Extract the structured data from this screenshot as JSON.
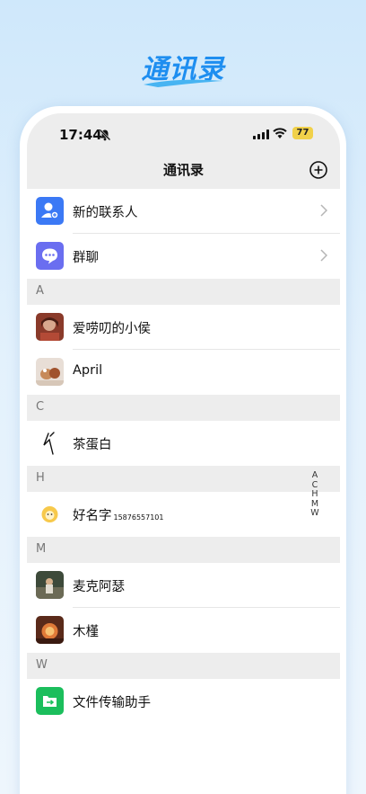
{
  "header": {
    "title": "通讯录"
  },
  "status_bar": {
    "time": "17:44",
    "battery": "77"
  },
  "nav": {
    "title": "通讯录"
  },
  "top_items": [
    {
      "label": "新的联系人",
      "icon": "new-contact-icon",
      "color": "#3b79f5"
    },
    {
      "label": "群聊",
      "icon": "group-chat-icon",
      "color": "#6a6ef0"
    }
  ],
  "sections": [
    {
      "letter": "A",
      "contacts": [
        {
          "name": "爱唠叨的小侯"
        },
        {
          "name": "April"
        }
      ]
    },
    {
      "letter": "C",
      "contacts": [
        {
          "name": "茶蛋白"
        }
      ]
    },
    {
      "letter": "H",
      "contacts": [
        {
          "name": "好名字",
          "sub": "15876557101"
        }
      ]
    },
    {
      "letter": "M",
      "contacts": [
        {
          "name": "麦克阿瑟"
        },
        {
          "name": "木槿"
        }
      ]
    },
    {
      "letter": "W",
      "contacts": [
        {
          "name": "文件传输助手"
        }
      ]
    }
  ],
  "index": [
    "A",
    "C",
    "H",
    "M",
    "W"
  ],
  "colors": {
    "accent": "#1e8ef0",
    "section_bg": "#ededed",
    "file_helper": "#1bbe5c"
  }
}
